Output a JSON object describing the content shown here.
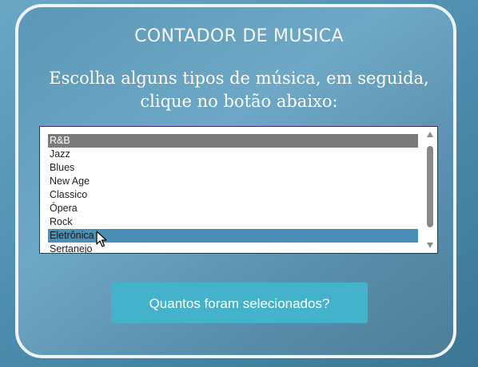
{
  "header": {
    "title": "CONTADOR DE MUSICA",
    "subtitle": "Escolha alguns tipos de música, em seguida, clique no botão abaixo:"
  },
  "genre_list": {
    "options": [
      {
        "label": "R&B",
        "selected": true
      },
      {
        "label": "Jazz",
        "selected": false
      },
      {
        "label": "Blues",
        "selected": false
      },
      {
        "label": "New Age",
        "selected": false
      },
      {
        "label": "Classico",
        "selected": false
      },
      {
        "label": "Ópera",
        "selected": false
      },
      {
        "label": "Rock",
        "selected": false
      },
      {
        "label": "Eletrônica",
        "selected": true
      },
      {
        "label": "Sertanejo",
        "selected": false
      }
    ]
  },
  "actions": {
    "count_button_label": "Quantos foram selecionados?"
  },
  "colors": {
    "button": "#45b2cc",
    "selected_inactive": "#7a7a7a",
    "selected_active": "#4a8fb5"
  }
}
